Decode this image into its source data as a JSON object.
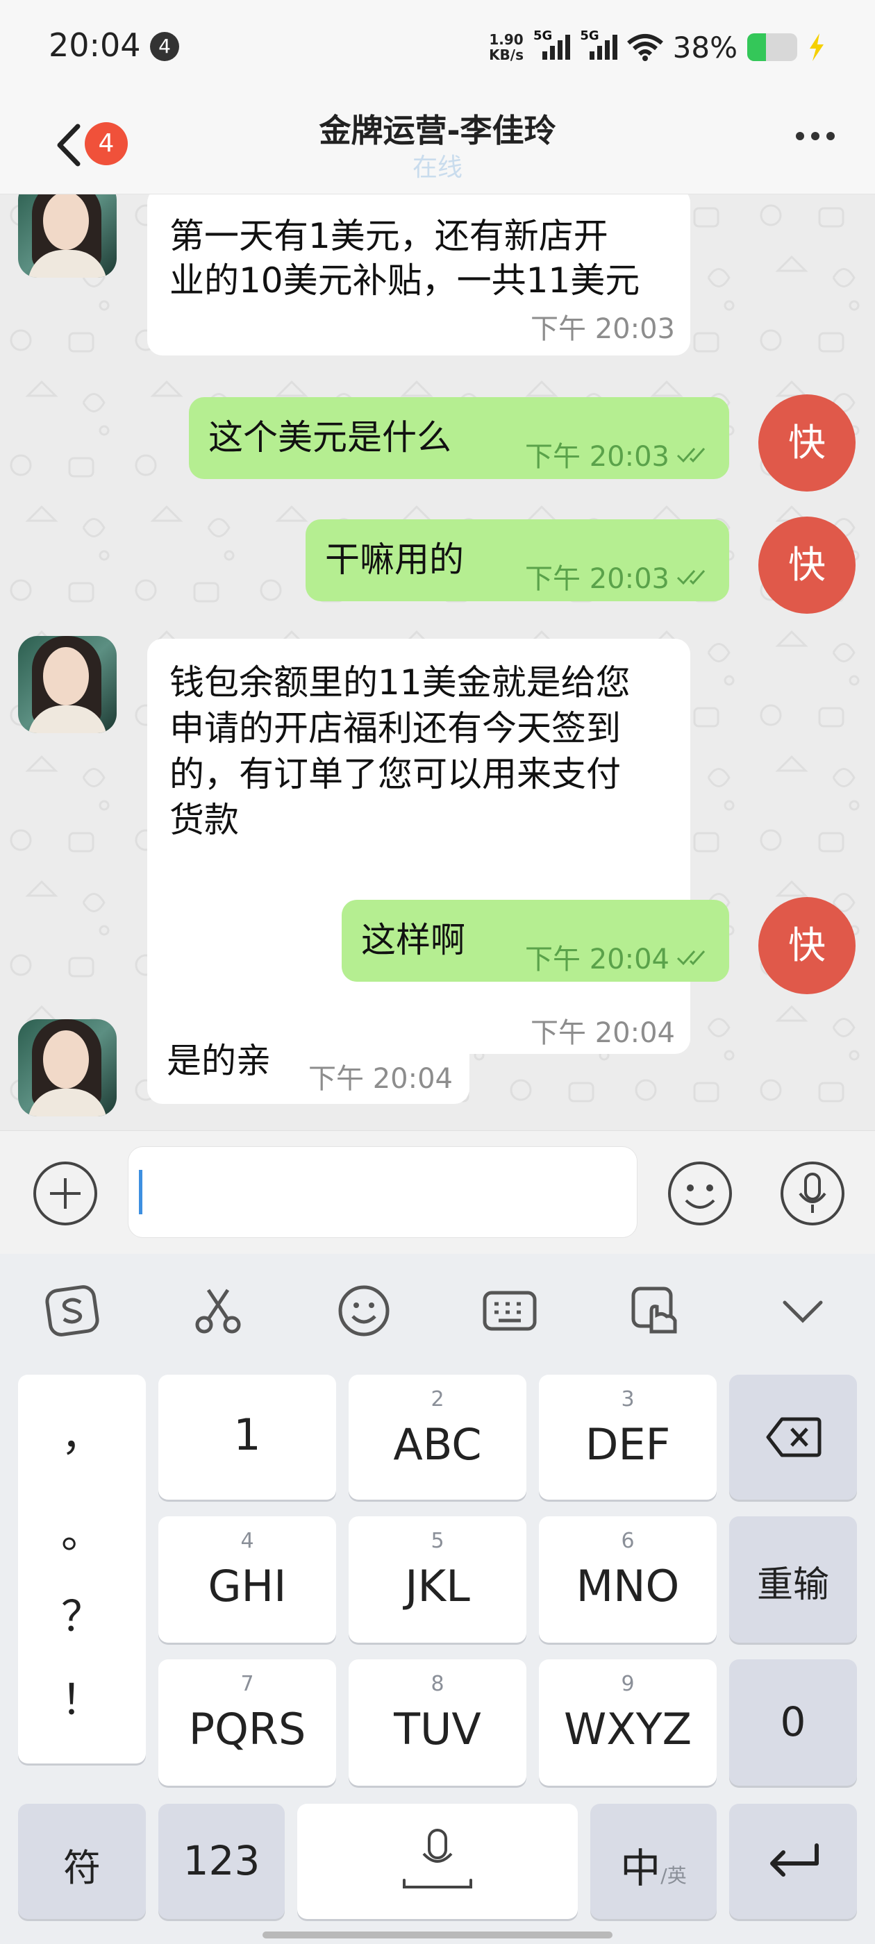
{
  "status_bar": {
    "time": "20:04",
    "notification_count": "4",
    "speed_value": "1.90",
    "speed_unit": "KB/s",
    "sim1": "5G",
    "sim2": "5G",
    "battery_percent": "38%",
    "battery_level": 0.38
  },
  "header": {
    "back_count": "4",
    "title": "金牌运营-李佳玲",
    "subtitle": "在线"
  },
  "quick_label": "快",
  "messages": [
    {
      "dir": "in",
      "text_lines": [
        "第一天有1美元，还有新店开",
        "业的10美元补贴，一共11美元"
      ],
      "time": "下午 20:03"
    },
    {
      "dir": "out",
      "text": "这个美元是什么",
      "time": "下午 20:03"
    },
    {
      "dir": "out",
      "text": "干嘛用的",
      "time": "下午 20:03"
    },
    {
      "dir": "in",
      "text_lines": [
        "钱包余额里的11美金就是给您",
        "申请的开店福利还有今天签到",
        "的，有订单了您可以用来支付",
        "货款"
      ],
      "time": "下午 20:04"
    },
    {
      "dir": "out",
      "text": "这样啊",
      "time": "下午 20:04"
    },
    {
      "dir": "in",
      "text": "是的亲",
      "time": "下午 20:04"
    }
  ],
  "input": {
    "value": ""
  },
  "keyboard": {
    "punct": [
      "，",
      "。",
      "？",
      "！"
    ],
    "keys": [
      {
        "num": "",
        "label": "1"
      },
      {
        "num": "2",
        "label": "ABC"
      },
      {
        "num": "3",
        "label": "DEF"
      },
      {
        "num": "4",
        "label": "GHI"
      },
      {
        "num": "5",
        "label": "JKL"
      },
      {
        "num": "6",
        "label": "MNO"
      },
      {
        "num": "7",
        "label": "PQRS"
      },
      {
        "num": "8",
        "label": "TUV"
      },
      {
        "num": "9",
        "label": "WXYZ"
      }
    ],
    "retype": "重输",
    "zero": "0",
    "symbols": "符",
    "numeric": "123",
    "lang_main": "中",
    "lang_alt": "/英"
  }
}
